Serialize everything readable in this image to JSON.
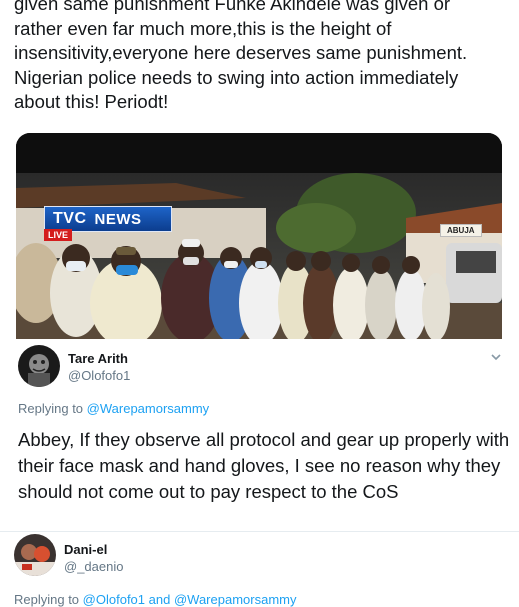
{
  "main_tweet": {
    "text": "given same punishment Funke Akindele was given or\nrather even far much more,this is the height of\ninsensitivity,everyone here deserves same punishment.\nNigerian police needs to swing into action immediately\nabout this! Periodt!",
    "video": {
      "logo_tvc": "TVC",
      "logo_news": "NEWS",
      "live_label": "LIVE",
      "sign_text": "ABUJA"
    }
  },
  "replies": [
    {
      "name": "Tare Arith",
      "handle": "@Olofofo1",
      "replying_prefix": "Replying to",
      "replying_to": "@Warepamorsammy",
      "text": "Abbey, If they observe all protocol and gear up properly with their face mask  and hand gloves, I see no reason why they should not come out to pay respect to the CoS"
    },
    {
      "name": "Dani-el",
      "handle": "@_daenio",
      "replying_prefix": "Replying to",
      "replying_to_1": "@Olofofo1",
      "replying_and": "and",
      "replying_to_2": "@Warepamorsammy"
    }
  ],
  "icons": {
    "menu": "chevron-down-icon"
  },
  "colors": {
    "link": "#1da1f2",
    "secondary_text": "#657786",
    "primary_text": "#14171a"
  }
}
